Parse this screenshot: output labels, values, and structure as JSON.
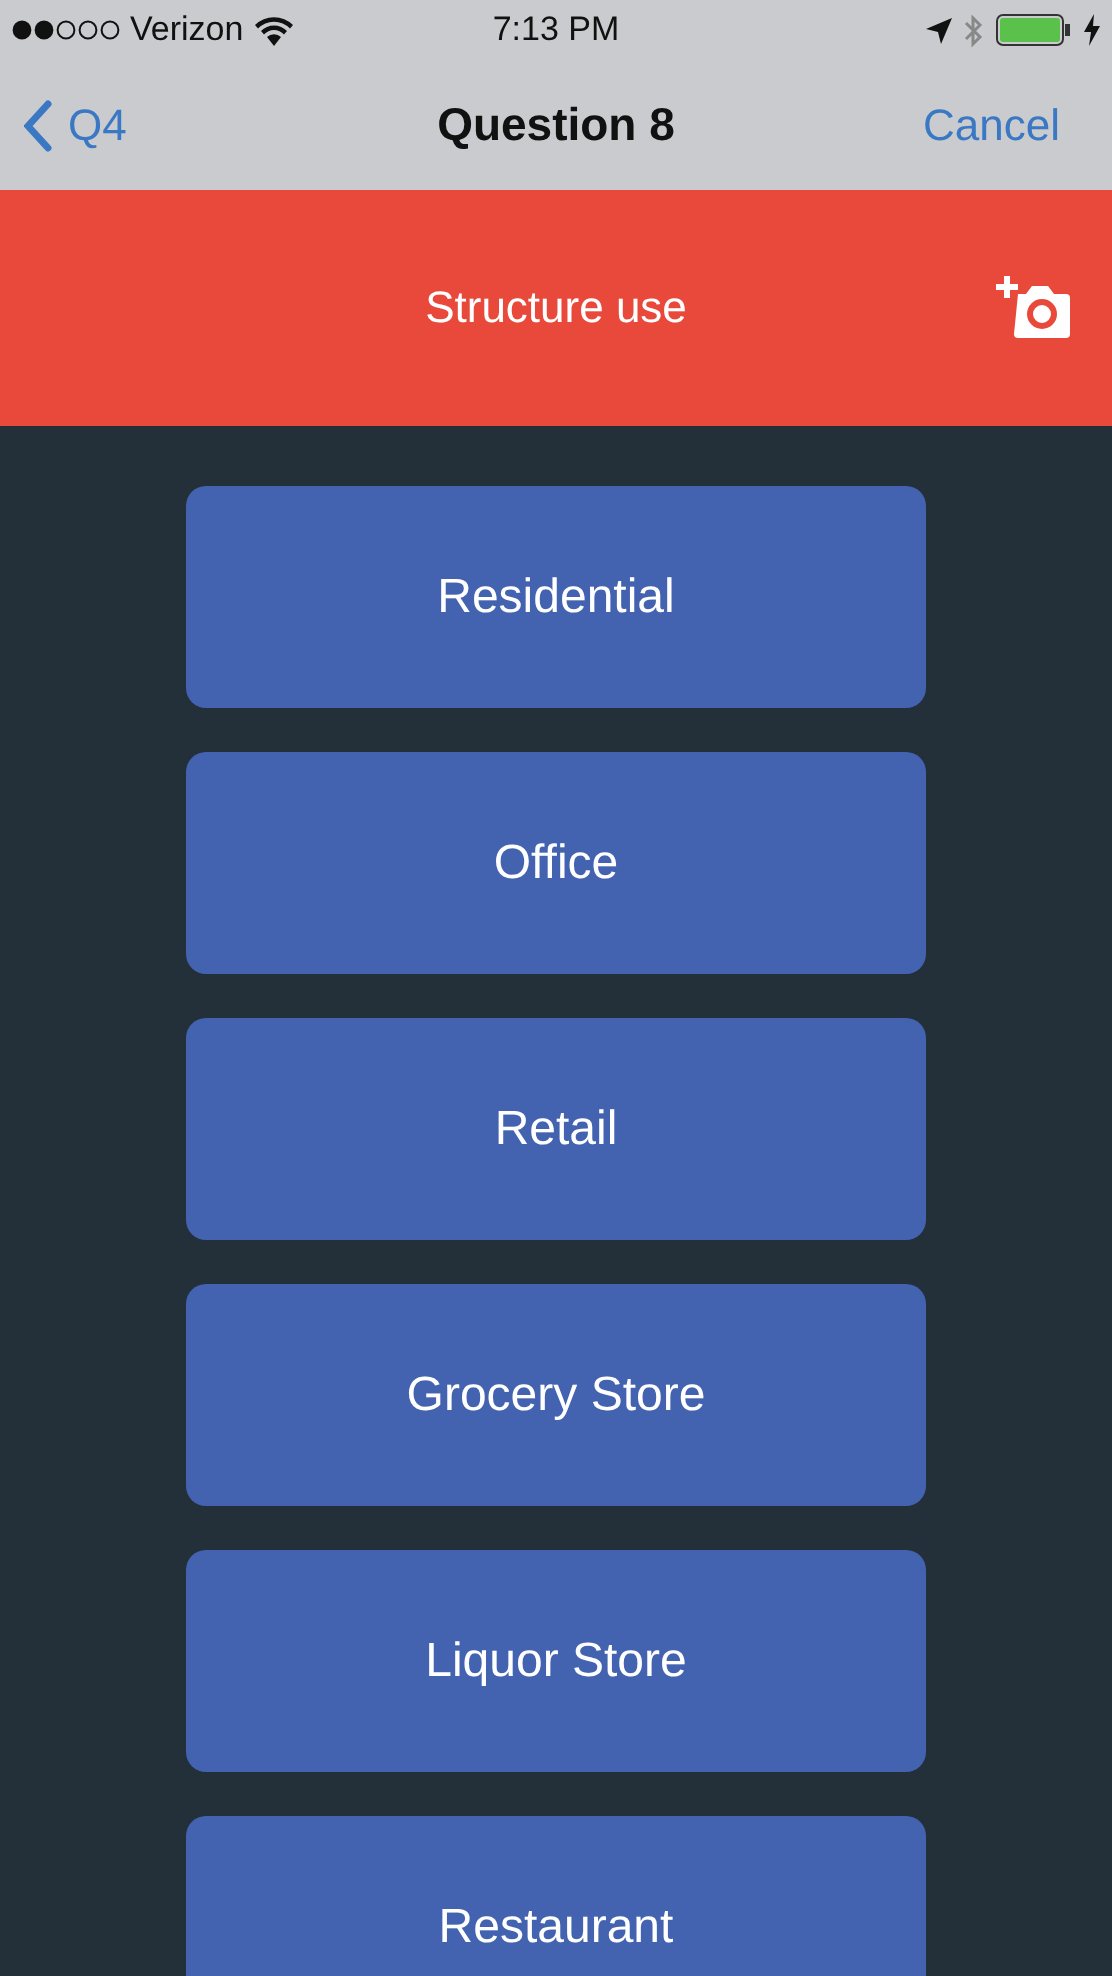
{
  "status_bar": {
    "carrier": "Verizon",
    "time": "7:13 PM"
  },
  "nav_bar": {
    "back_label": "Q4",
    "title": "Question 8",
    "action": "Cancel"
  },
  "header": {
    "title": "Structure use"
  },
  "options": [
    {
      "label": "Residential"
    },
    {
      "label": "Office"
    },
    {
      "label": "Retail"
    },
    {
      "label": "Grocery Store"
    },
    {
      "label": "Liquor Store"
    },
    {
      "label": "Restaurant"
    }
  ]
}
